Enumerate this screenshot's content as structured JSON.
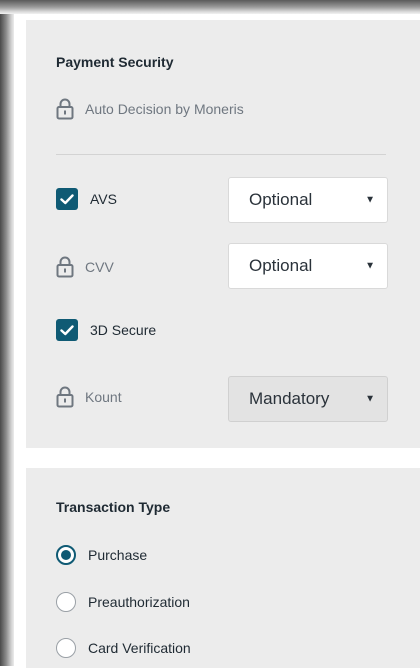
{
  "payment_security": {
    "title": "Payment Security",
    "auto_decision_label": "Auto Decision by Moneris",
    "avs": {
      "label": "AVS",
      "checked": true,
      "select_value": "Optional"
    },
    "cvv": {
      "label": "CVV",
      "locked": true,
      "select_value": "Optional"
    },
    "secure3d": {
      "label": "3D Secure",
      "checked": true
    },
    "kount": {
      "label": "Kount",
      "locked": true,
      "select_value": "Mandatory",
      "disabled": true
    }
  },
  "transaction_type": {
    "title": "Transaction Type",
    "options": [
      {
        "label": "Purchase",
        "selected": true
      },
      {
        "label": "Preauthorization",
        "selected": false
      },
      {
        "label": "Card Verification",
        "selected": false
      }
    ]
  },
  "colors": {
    "accent": "#0f5a74",
    "panel_bg": "#ececec",
    "muted_text": "#6f7780"
  },
  "icons": {
    "lock": "lock-icon",
    "check": "checkmark-icon",
    "caret": "caret-down-icon"
  }
}
